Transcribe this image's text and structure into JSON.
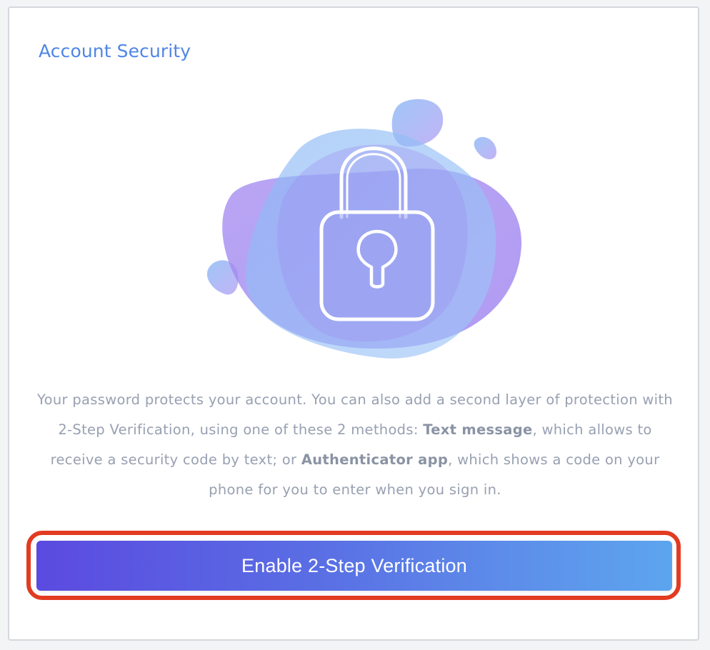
{
  "card": {
    "title": "Account Security"
  },
  "illustration": {
    "icon": "lock-icon"
  },
  "description": {
    "text_1": "Your password protects your account. You can also add a second layer of protection with 2-Step Verification, using one of these 2 methods: ",
    "method_1": "Text message",
    "text_2": ", which allows to receive a security code by text; or ",
    "method_2": "Authenticator app",
    "text_3": ", which shows a code on your phone for you to enter when you sign in."
  },
  "primary_button": {
    "label": "Enable 2-Step Verification"
  },
  "colors": {
    "title": "#4f86e6",
    "highlight": "#e23b22",
    "button_gradient_start": "#5b4ae0",
    "button_gradient_end": "#5da5ee"
  }
}
